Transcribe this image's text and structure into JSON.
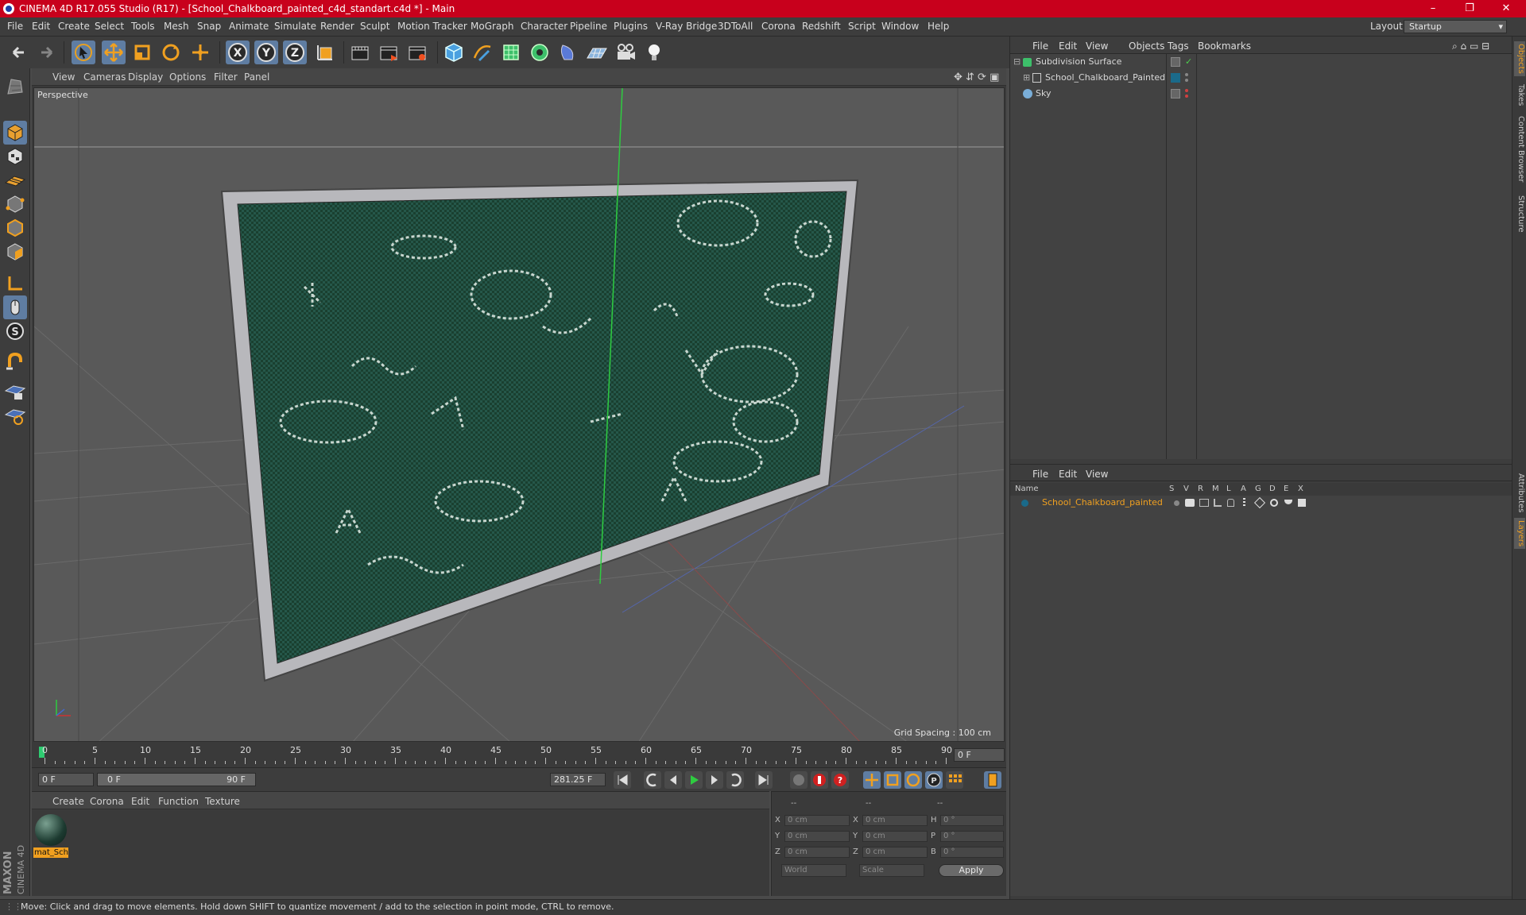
{
  "window": {
    "title": "CINEMA 4D R17.055 Studio (R17) - [School_Chalkboard_painted_c4d_standart.c4d *] - Main",
    "controls": [
      "–",
      "❐",
      "✕"
    ]
  },
  "menubar": {
    "items": [
      "File",
      "Edit",
      "Create",
      "Select",
      "Tools",
      "Mesh",
      "Snap",
      "Animate",
      "Simulate",
      "Render",
      "Sculpt",
      "Motion Tracker",
      "MoGraph",
      "Character",
      "Pipeline",
      "Plugins",
      "V-Ray Bridge",
      "3DToAll",
      "Corona",
      "Redshift",
      "Script",
      "Window",
      "Help"
    ],
    "layout_label": "Layout:",
    "layout_value": "Startup"
  },
  "viewport": {
    "menu": [
      "View",
      "Cameras",
      "Display",
      "Options",
      "Filter",
      "Panel"
    ],
    "camera_label": "Perspective",
    "grid_spacing": "Grid Spacing : 100 cm"
  },
  "timeline": {
    "ticks": [
      "0",
      "5",
      "10",
      "15",
      "20",
      "25",
      "30",
      "35",
      "40",
      "45",
      "50",
      "55",
      "60",
      "65",
      "70",
      "75",
      "80",
      "85",
      "90"
    ],
    "current_frame": "0 F",
    "start_frame": "0 F",
    "range_start": "0 F",
    "range_end": "90 F",
    "end_frame": "281.25 F"
  },
  "material_panel": {
    "menu": [
      "Create",
      "Corona",
      "Edit",
      "Function",
      "Texture"
    ],
    "material_name": "mat_Sch"
  },
  "coords_panel": {
    "headers": [
      "--",
      "--",
      "--"
    ],
    "rows": [
      {
        "a": "X",
        "av": "0 cm",
        "b": "X",
        "bv": "0 cm",
        "c": "H",
        "cv": "0 °"
      },
      {
        "a": "Y",
        "av": "0 cm",
        "b": "Y",
        "bv": "0 cm",
        "c": "P",
        "cv": "0 °"
      },
      {
        "a": "Z",
        "av": "0 cm",
        "b": "Z",
        "bv": "0 cm",
        "c": "B",
        "cv": "0 °"
      }
    ],
    "mode1": "World",
    "mode2": "Scale",
    "apply": "Apply"
  },
  "objects_panel": {
    "menu": [
      "File",
      "Edit",
      "View",
      "Objects",
      "Tags",
      "Bookmarks"
    ],
    "objects": [
      "Subdivision Surface",
      "School_Chalkboard_Painted",
      "Sky"
    ]
  },
  "layers_panel": {
    "menu": [
      "File",
      "Edit",
      "View"
    ],
    "columns": [
      "Name",
      "S",
      "V",
      "R",
      "M",
      "L",
      "A",
      "G",
      "D",
      "E",
      "X"
    ],
    "layer_name": "School_Chalkboard_painted"
  },
  "right_tabs": [
    "Objects",
    "Takes",
    "Content Browser",
    "Structure",
    "Attributes",
    "Layers"
  ],
  "status": "Move: Click and drag to move elements. Hold down SHIFT to quantize movement / add to the selection in point mode, CTRL to remove.",
  "brand": {
    "line1": "MAXON",
    "line2": "CINEMA 4D"
  },
  "colors": {
    "titlebar": "#c8001c",
    "accent": "#5f7da2",
    "chalkboard": "#1e4a3a",
    "selected_text": "#f0a020"
  }
}
